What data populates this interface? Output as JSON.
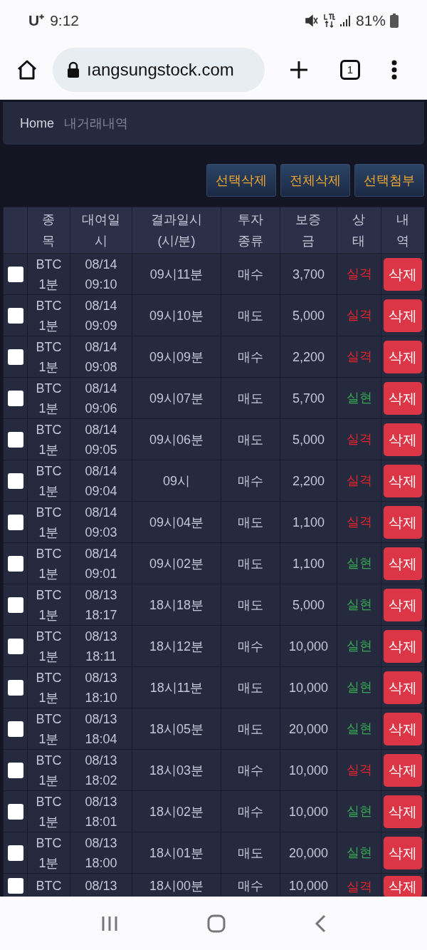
{
  "status_bar": {
    "carrier": "U⁺",
    "time": "9:12",
    "battery": "81%"
  },
  "browser": {
    "url": "ıangsungstock.com",
    "tab_count": "1"
  },
  "breadcrumb": {
    "home": "Home",
    "current": "내거래내역"
  },
  "actions": [
    "선택삭제",
    "전체삭제",
    "선택첨부"
  ],
  "table": {
    "columns": [
      "종목",
      "대여일시",
      "결과일시 (시/분)",
      "투자 종류",
      "보증금",
      "상태",
      "내역"
    ],
    "rows": [
      {
        "symbol": "BTC 1분",
        "rented": "08/14 09:10",
        "result_time": "09시11분",
        "type": "매수",
        "deposit": "3,700",
        "status": "실격",
        "kind": "loss",
        "checked": false,
        "action": "삭제"
      },
      {
        "symbol": "BTC 1분",
        "rented": "08/14 09:09",
        "result_time": "09시10분",
        "type": "매도",
        "deposit": "5,000",
        "status": "실격",
        "kind": "loss",
        "checked": false,
        "action": "삭제"
      },
      {
        "symbol": "BTC 1분",
        "rented": "08/14 09:08",
        "result_time": "09시09분",
        "type": "매수",
        "deposit": "2,200",
        "status": "실격",
        "kind": "loss",
        "checked": false,
        "action": "삭제"
      },
      {
        "symbol": "BTC 1분",
        "rented": "08/14 09:06",
        "result_time": "09시07분",
        "type": "매도",
        "deposit": "5,700",
        "status": "실현",
        "kind": "win",
        "checked": false,
        "action": "삭제"
      },
      {
        "symbol": "BTC 1분",
        "rented": "08/14 09:05",
        "result_time": "09시06분",
        "type": "매도",
        "deposit": "5,000",
        "status": "실격",
        "kind": "loss",
        "checked": false,
        "action": "삭제"
      },
      {
        "symbol": "BTC 1분",
        "rented": "08/14 09:04",
        "result_time": "09시",
        "type": "매수",
        "deposit": "2,200",
        "status": "실격",
        "kind": "loss",
        "checked": false,
        "action": "삭제"
      },
      {
        "symbol": "BTC 1분",
        "rented": "08/14 09:03",
        "result_time": "09시04분",
        "type": "매도",
        "deposit": "1,100",
        "status": "실격",
        "kind": "loss",
        "checked": false,
        "action": "삭제"
      },
      {
        "symbol": "BTC 1분",
        "rented": "08/14 09:01",
        "result_time": "09시02분",
        "type": "매도",
        "deposit": "1,100",
        "status": "실현",
        "kind": "win",
        "checked": false,
        "action": "삭제"
      },
      {
        "symbol": "BTC 1분",
        "rented": "08/13 18:17",
        "result_time": "18시18분",
        "type": "매도",
        "deposit": "5,000",
        "status": "실현",
        "kind": "win",
        "checked": false,
        "action": "삭제"
      },
      {
        "symbol": "BTC 1분",
        "rented": "08/13 18:11",
        "result_time": "18시12분",
        "type": "매수",
        "deposit": "10,000",
        "status": "실현",
        "kind": "win",
        "checked": false,
        "action": "삭제"
      },
      {
        "symbol": "BTC 1분",
        "rented": "08/13 18:10",
        "result_time": "18시11분",
        "type": "매도",
        "deposit": "10,000",
        "status": "실현",
        "kind": "win",
        "checked": false,
        "action": "삭제"
      },
      {
        "symbol": "BTC 1분",
        "rented": "08/13 18:04",
        "result_time": "18시05분",
        "type": "매도",
        "deposit": "20,000",
        "status": "실현",
        "kind": "win",
        "checked": false,
        "action": "삭제"
      },
      {
        "symbol": "BTC 1분",
        "rented": "08/13 18:02",
        "result_time": "18시03분",
        "type": "매수",
        "deposit": "10,000",
        "status": "실격",
        "kind": "loss",
        "checked": false,
        "action": "삭제"
      },
      {
        "symbol": "BTC 1분",
        "rented": "08/13 18:01",
        "result_time": "18시02분",
        "type": "매수",
        "deposit": "10,000",
        "status": "실현",
        "kind": "win",
        "checked": false,
        "action": "삭제"
      },
      {
        "symbol": "BTC 1분",
        "rented": "08/13 18:00",
        "result_time": "18시01분",
        "type": "매도",
        "deposit": "20,000",
        "status": "실현",
        "kind": "win",
        "checked": false,
        "action": "삭제"
      },
      {
        "symbol": "BTC",
        "rented": "08/13",
        "result_time": "18시00분",
        "type": "매수",
        "deposit": "10,000",
        "status": "실격",
        "kind": "loss",
        "checked": false,
        "action": "삭제"
      }
    ]
  }
}
